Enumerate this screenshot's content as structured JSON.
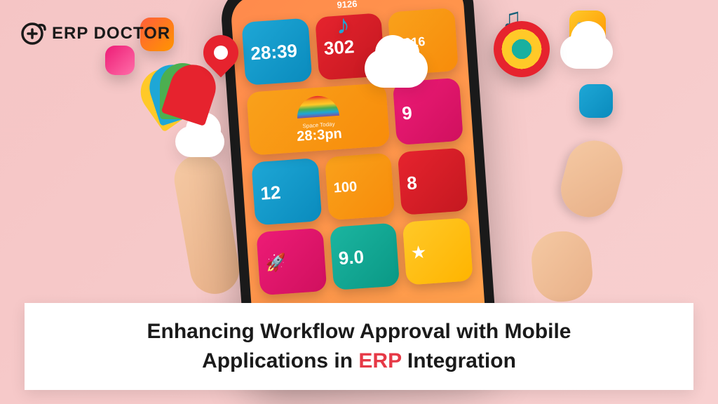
{
  "logo": {
    "text": "ERP DOCTOR"
  },
  "phone": {
    "status_time": "9126",
    "widgets": {
      "w1": "28:39",
      "w2": "302",
      "w3": "2016",
      "w4": "12",
      "w5": "28:3pn",
      "w6": "9",
      "w7": "8",
      "w8": "100",
      "w9": "9.0",
      "label_space": "Space Today"
    }
  },
  "caption": {
    "line1_pre": "Enhancing Workflow Approval with Mobile",
    "line2_pre": "Applications in ",
    "highlight": "ERP",
    "line2_post": " Integration"
  }
}
